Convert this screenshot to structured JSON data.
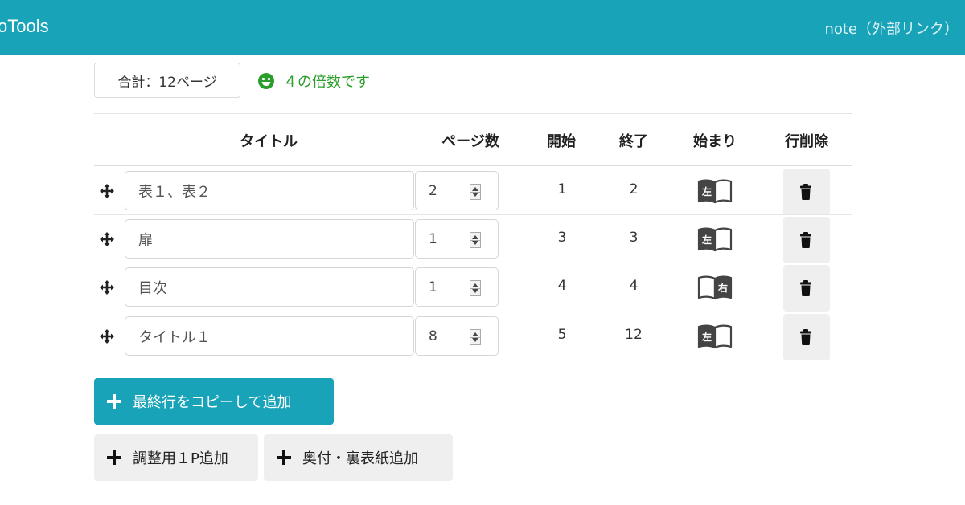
{
  "app": {
    "brand": "oTools",
    "external_link": "note（外部リンク）"
  },
  "summary": {
    "total_label": "合計：12ページ",
    "status_text": "４の倍数です",
    "status_icon": "smile-icon"
  },
  "table": {
    "headers": {
      "title": "タイトル",
      "pages": "ページ数",
      "start": "開始",
      "end": "終了",
      "begin_side": "始まり",
      "delete": "行削除"
    },
    "rows": [
      {
        "title": "表１、表２",
        "pages": "2",
        "start": "1",
        "end": "2",
        "side": "左",
        "side_position": "left"
      },
      {
        "title": "扉",
        "pages": "1",
        "start": "3",
        "end": "3",
        "side": "左",
        "side_position": "left"
      },
      {
        "title": "目次",
        "pages": "1",
        "start": "4",
        "end": "4",
        "side": "右",
        "side_position": "right"
      },
      {
        "title": "タイトル１",
        "pages": "8",
        "start": "5",
        "end": "12",
        "side": "左",
        "side_position": "left"
      }
    ]
  },
  "buttons": {
    "copy_last": "最終行をコピーして追加",
    "add_adjust": "調整用１P追加",
    "add_colophon": "奥付・裏表紙追加"
  },
  "colors": {
    "accent": "#19a3b8",
    "success": "#2a9d2a",
    "button_gray": "#efefef"
  }
}
